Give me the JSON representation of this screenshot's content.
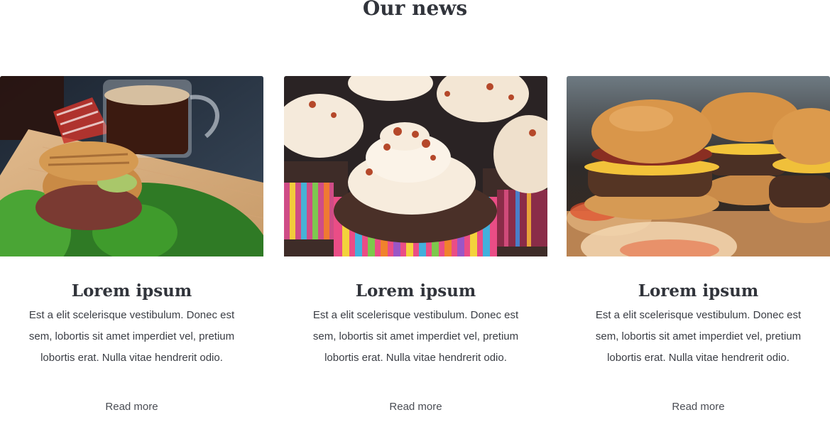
{
  "section": {
    "title": "Our news"
  },
  "cards": [
    {
      "image_subject": "sandwich-and-coffee-photo",
      "title": "Lorem ipsum",
      "text": "Est a elit scelerisque vestibulum. Donec est sem, lobortis sit amet imperdiet vel, pretium lobortis erat. Nulla vitae hendrerit odio.",
      "link_label": "Read more"
    },
    {
      "image_subject": "cupcakes-photo",
      "title": "Lorem ipsum",
      "text": "Est a elit scelerisque vestibulum. Donec est sem, lobortis sit amet imperdiet vel, pretium lobortis erat. Nulla vitae hendrerit odio.",
      "link_label": "Read more"
    },
    {
      "image_subject": "burgers-photo",
      "title": "Lorem ipsum",
      "text": "Est a elit scelerisque vestibulum. Donec est sem, lobortis sit amet imperdiet vel, pretium lobortis erat. Nulla vitae hendrerit odio.",
      "link_label": "Read more"
    }
  ]
}
